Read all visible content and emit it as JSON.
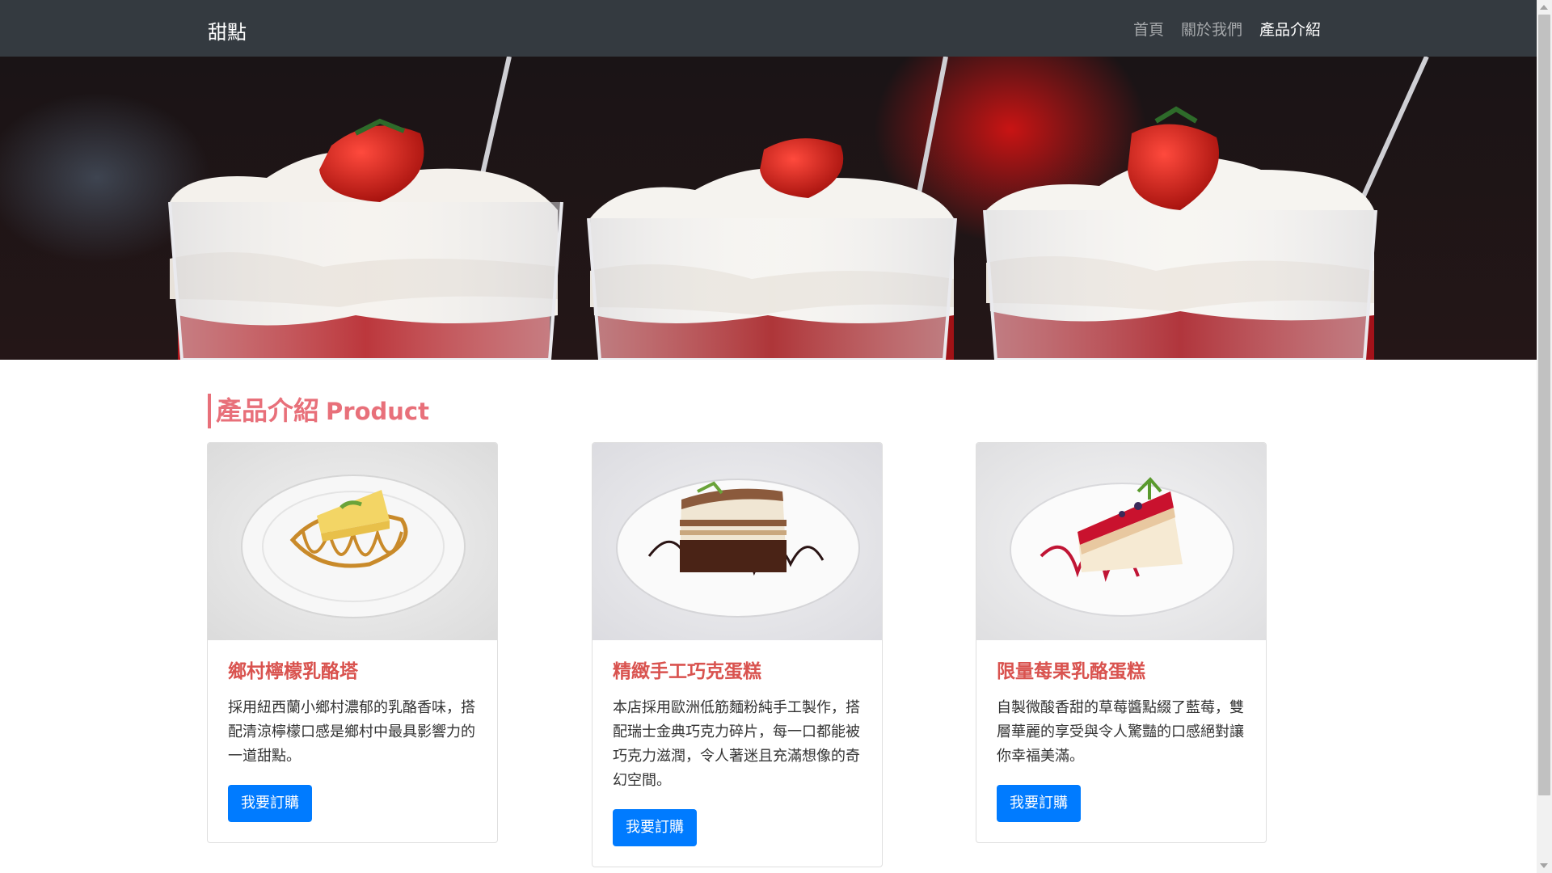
{
  "navbar": {
    "brand": "甜點",
    "links": [
      {
        "label": "首頁",
        "active": false
      },
      {
        "label": "關於我們",
        "active": false
      },
      {
        "label": "產品介紹",
        "active": true
      }
    ]
  },
  "section": {
    "title_zh": "產品介紹",
    "title_en": "Product"
  },
  "products": [
    {
      "name": "鄉村檸檬乳酪塔",
      "description": "採用紐西蘭小鄉村濃郁的乳酪香味，搭配清涼檸檬口感是鄉村中最具影響力的一道甜點。",
      "button": "我要訂購",
      "image_icon": "lemon-cheese-tart-image"
    },
    {
      "name": "精緻手工巧克蛋糕",
      "description": "本店採用歐洲低筋麵粉純手工製作，搭配瑞士金典巧克力碎片，每一口都能被巧克力滋潤，令人著迷且充滿想像的奇幻空間。",
      "button": "我要訂購",
      "image_icon": "chocolate-cake-image"
    },
    {
      "name": "限量莓果乳酪蛋糕",
      "description": "自製微酸香甜的草莓醬點綴了藍莓，雙層華麗的享受與令人驚豔的口感絕對讓你幸福美滿。",
      "button": "我要訂購",
      "image_icon": "berry-cheesecake-image"
    }
  ],
  "colors": {
    "navbar_bg": "#343a40",
    "accent": "#e8707a",
    "card_title": "#d9534f",
    "button": "#007bff"
  }
}
